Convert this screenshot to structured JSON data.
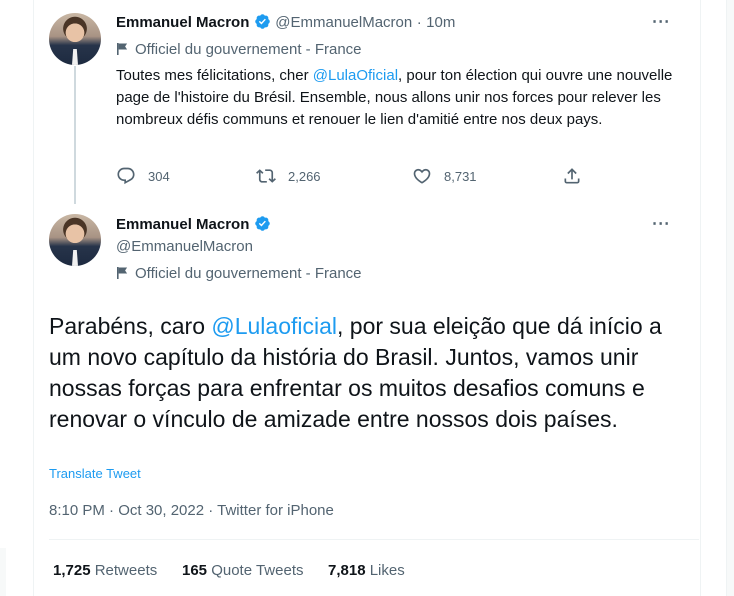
{
  "tweet1": {
    "name": "Emmanuel Macron",
    "handle": "@EmmanuelMacron",
    "separator": "·",
    "time": "10m",
    "label": "Officiel du gouvernement - France",
    "text_before": "Toutes mes félicitations, cher ",
    "mention": "@LulaOficial",
    "text_after": ", pour ton élection qui ouvre une nouvelle page de l'histoire du Brésil. Ensemble, nous allons unir nos forces pour relever les nombreux défis communs et renouer le lien d'amitié entre nos deux pays.",
    "replies": "304",
    "retweets": "2,266",
    "likes": "8,731"
  },
  "tweet2": {
    "name": "Emmanuel Macron",
    "handle": "@EmmanuelMacron",
    "label": "Officiel du gouvernement - France",
    "text_before": "Parabéns, caro ",
    "mention": "@Lulaoficial",
    "text_after": ", por sua eleição que dá início a um novo capítulo da história do Brasil. Juntos, vamos unir nossas forças para enfrentar os muitos desafios comuns e renovar o vínculo de amizade entre nossos dois países.",
    "translate": "Translate Tweet",
    "meta": "8:10 PM · Oct 30, 2022 · Twitter for iPhone",
    "retweets_count": "1,725",
    "retweets_label": "Retweets",
    "quotes_count": "165",
    "quotes_label": "Quote Tweets",
    "likes_count": "7,818",
    "likes_label": "Likes"
  },
  "icons": [
    "verified-badge-icon",
    "more-options-icon",
    "flag-icon",
    "reply-icon",
    "retweet-icon",
    "like-icon",
    "share-icon"
  ],
  "colors": {
    "accent": "#1d9bf0",
    "text": "#0f1419",
    "muted": "#536471"
  }
}
